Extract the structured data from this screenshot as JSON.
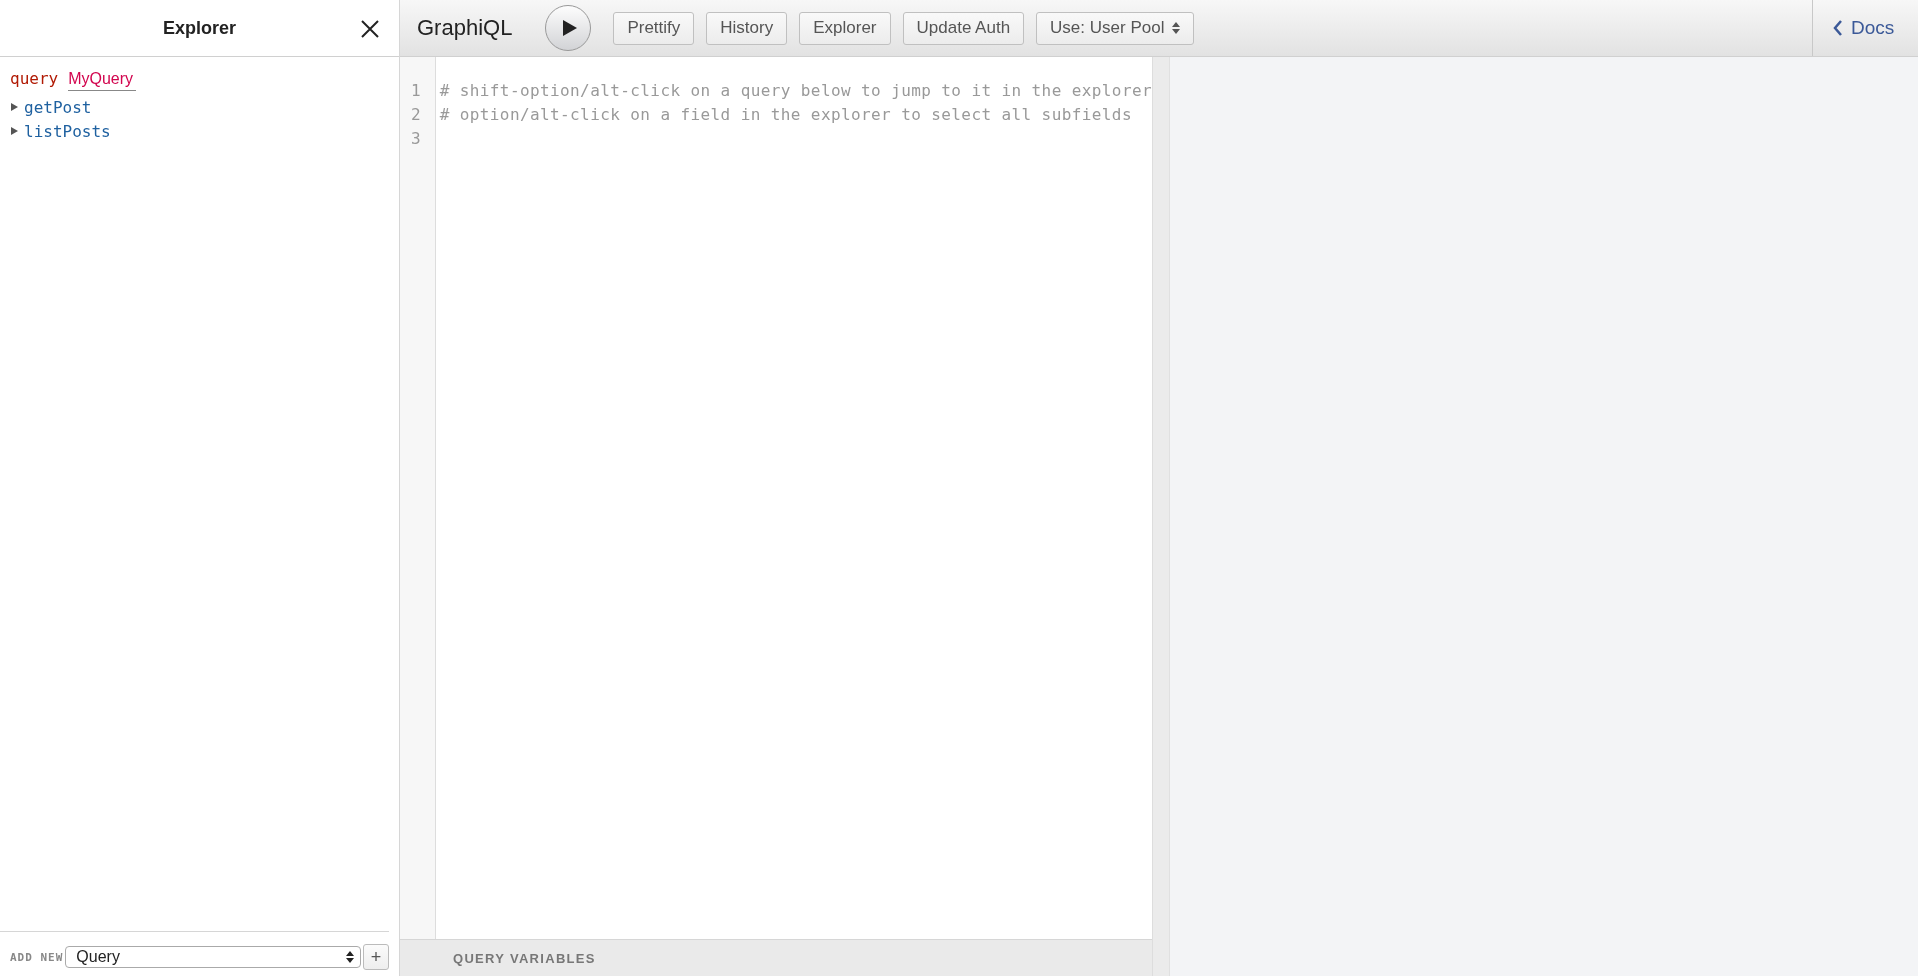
{
  "explorer": {
    "title": "Explorer",
    "operation": {
      "keyword": "query",
      "name": "MyQuery"
    },
    "fields": [
      {
        "name": "getPost",
        "expanded": false
      },
      {
        "name": "listPosts",
        "expanded": false
      }
    ],
    "add_new": {
      "label": "ADD NEW",
      "value": "Query",
      "button": "+"
    }
  },
  "toolbar": {
    "title": "GraphiQL",
    "buttons": [
      {
        "kind": "button",
        "label": "Prettify"
      },
      {
        "kind": "button",
        "label": "History"
      },
      {
        "kind": "button",
        "label": "Explorer"
      },
      {
        "kind": "button",
        "label": "Update Auth"
      },
      {
        "kind": "select",
        "label": "Use: User Pool"
      }
    ],
    "docs": "Docs"
  },
  "editor": {
    "lines": [
      {
        "number": "1",
        "text": "# shift-option/alt-click on a query below to jump to it in the explorer"
      },
      {
        "number": "2",
        "text": "# option/alt-click on a field in the explorer to select all subfields"
      },
      {
        "number": "3"
      }
    ],
    "variables_label": "QUERY VARIABLES"
  }
}
